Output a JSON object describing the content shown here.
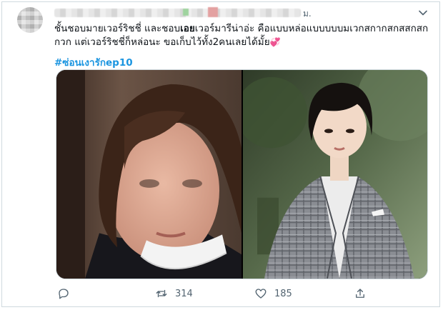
{
  "tweet": {
    "author_suffix": "ม.",
    "text_line1_a": "ชั้นชอบมายเวอร์ริชชี่ และชอบ",
    "text_line1_bold": "เอย",
    "text_line1_b": "เวอร์มารีน่าอ่ะ คือแบบหล่อแบบบบบมเวกสกากสกสสกสก",
    "text_line2": "กวก แต่เวอร์ริชชี่ก็หล่อนะ ขอเก็บไว้ทั้ง2คนเลยได้มั้ย",
    "text_line2_emoji": "💞",
    "hashtag": "#ซ่อนเงารักep10"
  },
  "media": {
    "photo_left": "woman-with-mask-under-chin",
    "photo_right": "person-in-plaid-blazer"
  },
  "actions": {
    "reply_count": "",
    "retweet_count": "314",
    "like_count": "185"
  },
  "icons": {
    "more": "chevron-down-icon",
    "reply": "reply-icon",
    "retweet": "retweet-icon",
    "like": "heart-icon",
    "share": "share-icon"
  },
  "colors": {
    "accent": "#1b95e0",
    "muted": "#536471",
    "border": "#cfd9de"
  }
}
